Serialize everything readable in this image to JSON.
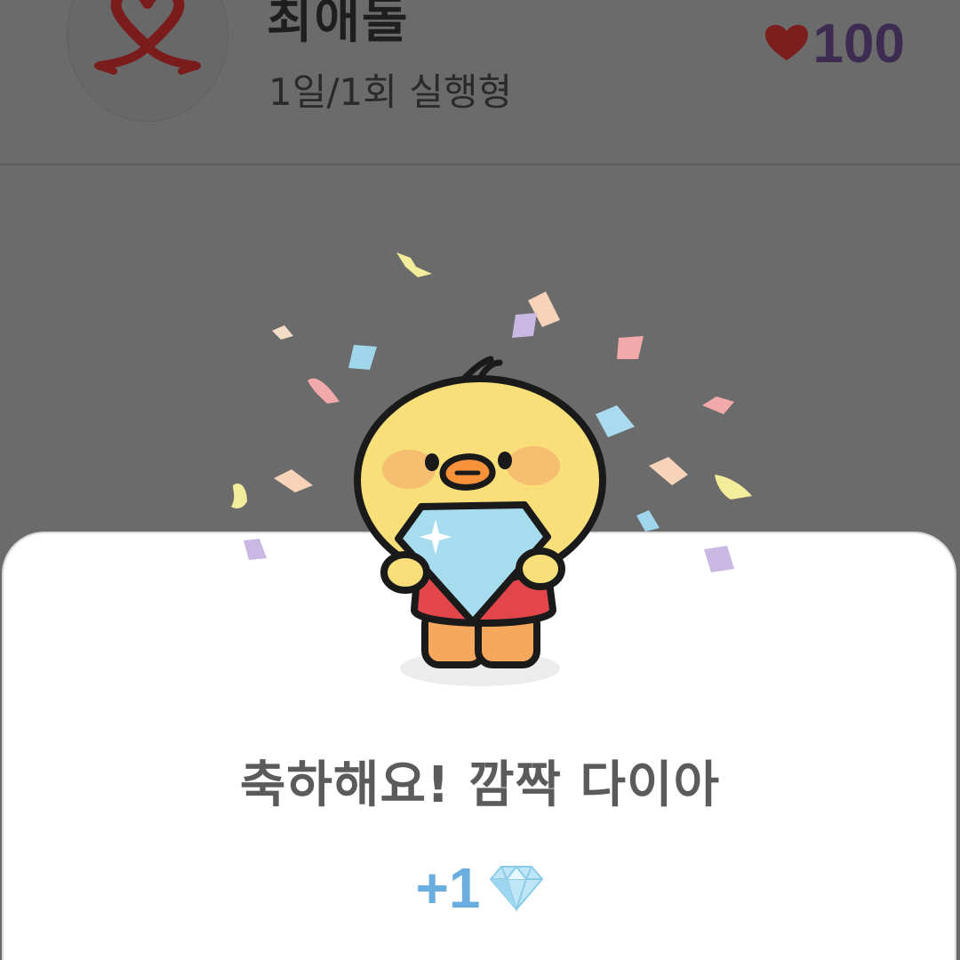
{
  "header": {
    "title": "최애돌",
    "subtitle": "1일/1회 실행형",
    "points_value": "100",
    "points_icon": "heart-icon",
    "logo_icon": "heart-ribbon-logo"
  },
  "dialog": {
    "title": "축하해요! 깜짝 다이아",
    "reward_amount": "+1",
    "reward_icon": "diamond-icon",
    "illustration": "duck-holding-diamond"
  },
  "colors": {
    "overlay": "#6b6b6b",
    "points_text": "#3e2b52",
    "heart": "#7a1e1e",
    "reward_text": "#6aaedf",
    "sheet_bg": "#ffffff"
  }
}
